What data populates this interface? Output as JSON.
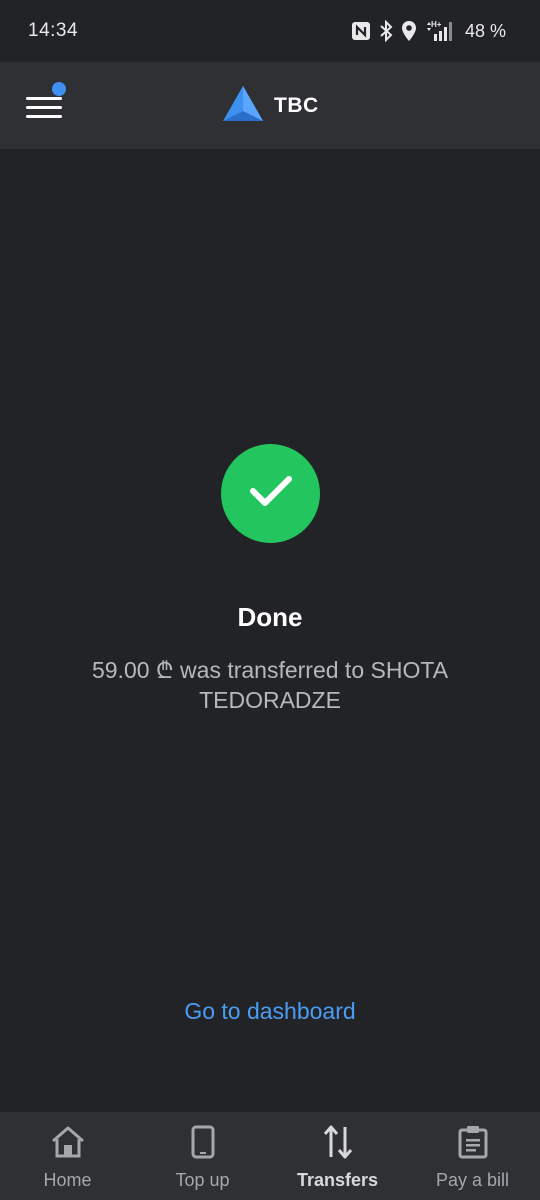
{
  "status_bar": {
    "time": "14:34",
    "network": "H+",
    "battery": "48 %",
    "icons": [
      "nfc-icon",
      "bluetooth-icon",
      "location-icon",
      "signal-icon"
    ]
  },
  "header": {
    "brand": "TBC",
    "menu_icon": "hamburger-menu-icon",
    "has_notification": true
  },
  "result": {
    "status_icon": "checkmark-icon",
    "title": "Done",
    "message": "59.00 ₾ was transferred to SHOTA TEDORADZE",
    "link": "Go to dashboard"
  },
  "bottom_nav": {
    "items": [
      {
        "label": "Home",
        "icon": "home-icon",
        "active": false
      },
      {
        "label": "Top up",
        "icon": "phone-icon",
        "active": false
      },
      {
        "label": "Transfers",
        "icon": "transfer-arrows-icon",
        "active": true
      },
      {
        "label": "Pay a bill",
        "icon": "clipboard-icon",
        "active": false
      }
    ]
  },
  "colors": {
    "background": "#222326",
    "header": "#2f3034",
    "success": "#22c55e",
    "link": "#4a9cf5",
    "accent": "#3d8ff0"
  }
}
